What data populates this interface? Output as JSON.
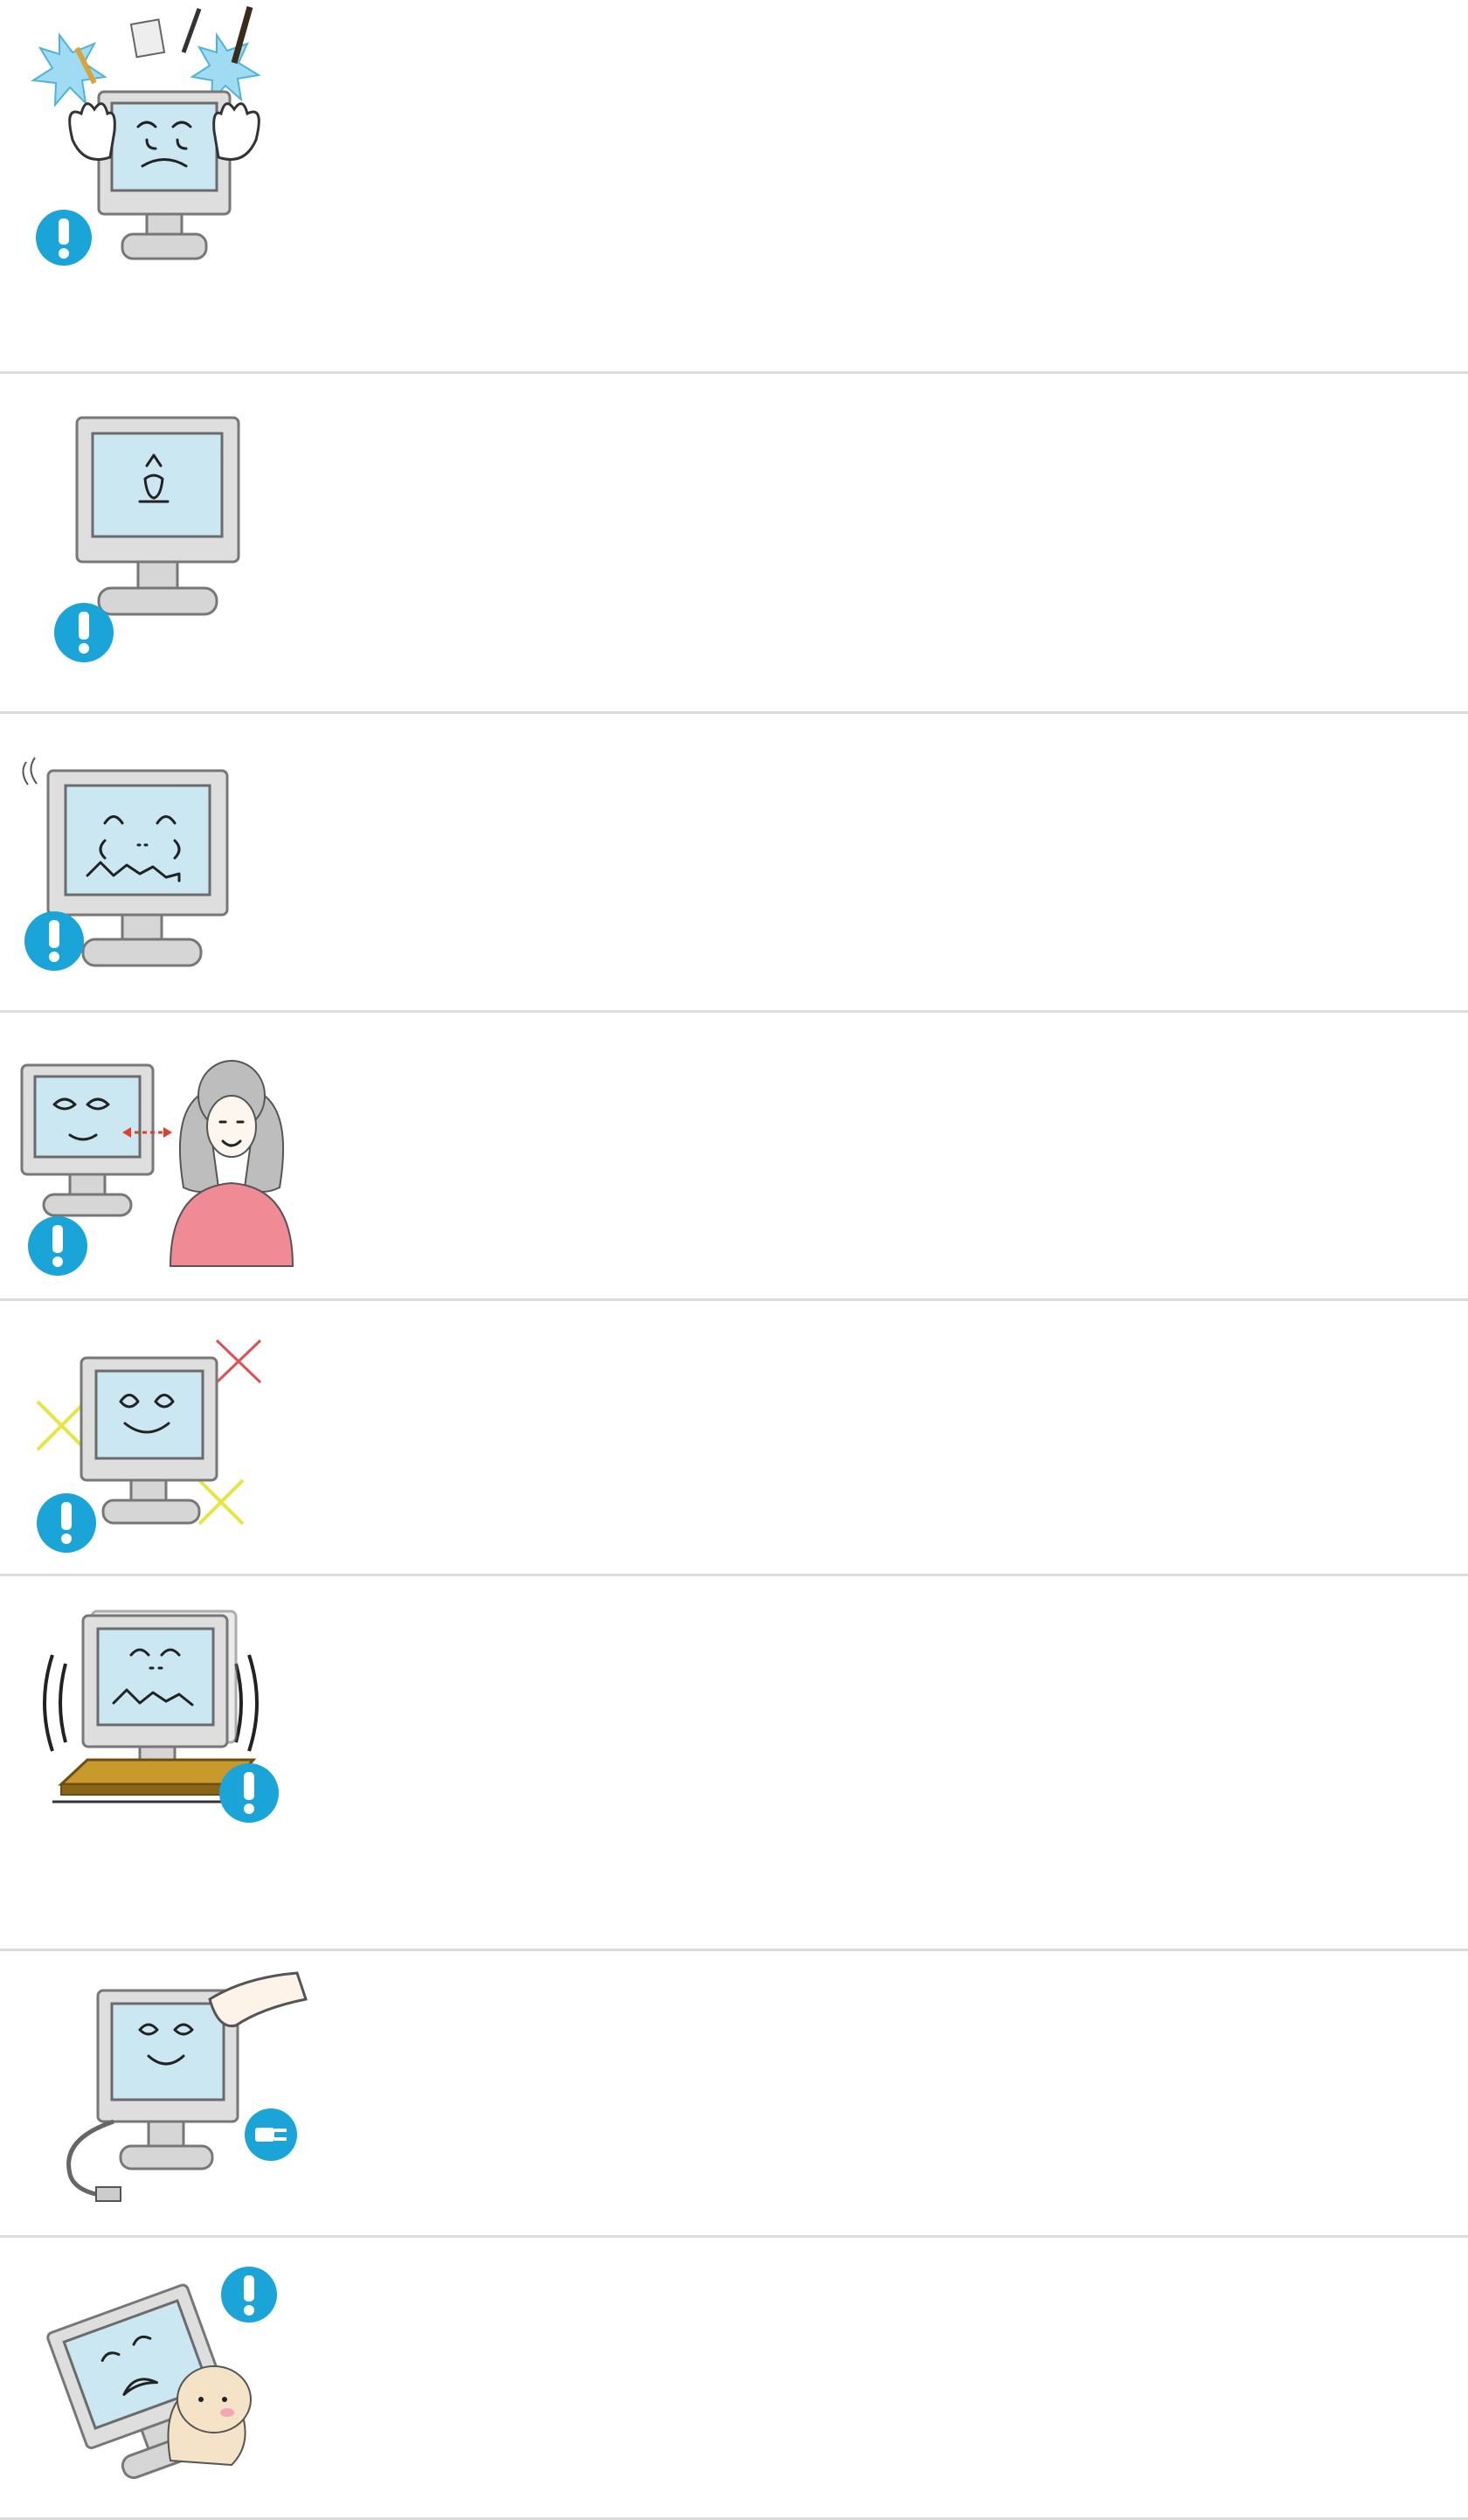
{
  "page": {
    "background": "#ffffff",
    "divider_color": "#dcdcdc"
  },
  "icons": {
    "warning": "exclamation-icon",
    "warning_color": "#1aa4d8",
    "unplug": "unplug-icon"
  },
  "illustrations": [
    {
      "id": "foreign-objects",
      "icon": "monitor-with-foreign-objects"
    },
    {
      "id": "static-image",
      "icon": "monitor-with-static-image"
    },
    {
      "id": "low-frequency",
      "icon": "monitor-distressed"
    },
    {
      "id": "viewing-distance",
      "icon": "monitor-and-viewer"
    },
    {
      "id": "placement",
      "icon": "monitor-placement-warning"
    },
    {
      "id": "unstable-surface",
      "icon": "monitor-on-shaking-surface"
    },
    {
      "id": "cleaning-unplug",
      "icon": "monitor-wipe-and-unplug"
    },
    {
      "id": "child-safety",
      "icon": "monitor-falling-on-child"
    }
  ]
}
